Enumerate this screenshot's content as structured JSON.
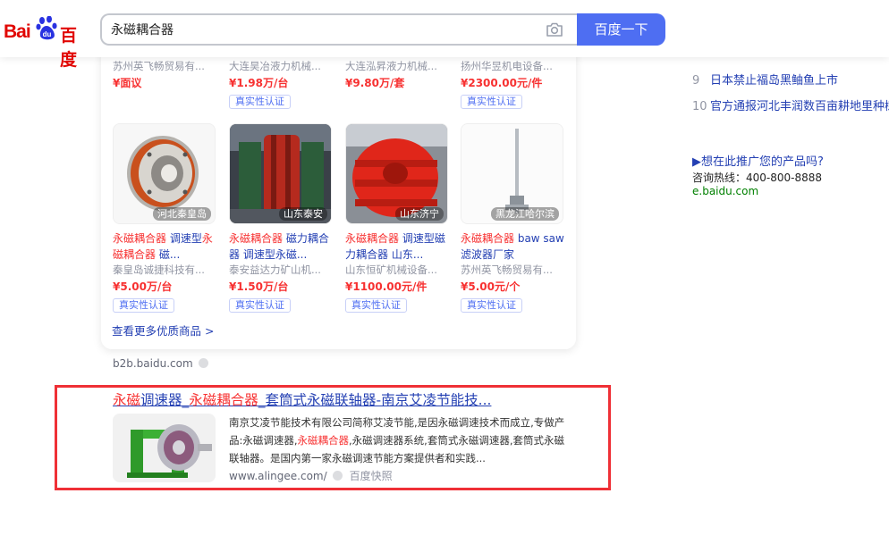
{
  "search": {
    "query": "永磁耦合器",
    "button_label": "百度一下"
  },
  "logo": {
    "text_bai": "Bai",
    "text_du": "du",
    "text_cn": "百度"
  },
  "product_top_row": [
    {
      "supplier": "苏州英飞畅贸易有...",
      "price": "¥面议",
      "verify": ""
    },
    {
      "supplier": "大连昊冶液力机械...",
      "price": "¥1.98万/台",
      "verify": "真实性认证"
    },
    {
      "supplier": "大连泓昇液力机械...",
      "price": "¥9.80万/套",
      "verify": ""
    },
    {
      "supplier": "扬州华昱机电设备...",
      "price": "¥2300.00元/件",
      "verify": "真实性认证"
    }
  ],
  "product_second_row": [
    {
      "location": "河北秦皇岛",
      "title_hl1": "永磁耦合器",
      "title_mid": " 调速型",
      "title_hl2": "永磁耦合器",
      "title_end": " 磁...",
      "supplier": "秦皇岛诚捷科技有...",
      "price": "¥5.00万/台",
      "verify": "真实性认证"
    },
    {
      "location": "山东泰安",
      "title_hl1": "永磁耦合器",
      "title_mid": " 磁力耦合器 调速型永磁...",
      "title_hl2": "",
      "title_end": "",
      "supplier": "泰安益达力矿山机...",
      "price": "¥1.50万/台",
      "verify": "真实性认证"
    },
    {
      "location": "山东济宁",
      "title_hl1": "永磁耦合器",
      "title_mid": " 调速型磁力耦合器 山东...",
      "title_hl2": "",
      "title_end": "",
      "supplier": "山东恒矿机械设备...",
      "price": "¥1100.00元/件",
      "verify": "真实性认证"
    },
    {
      "location": "黑龙江哈尔滨",
      "title_hl1": "永磁耦合器",
      "title_mid": " baw saw 滤波器厂家",
      "title_hl2": "",
      "title_end": "",
      "supplier": "苏州英飞畅贸易有...",
      "price": "¥5.00元/个",
      "verify": "真实性认证"
    }
  ],
  "more_link": "查看更多优质商品 >",
  "b2b_source": "b2b.baidu.com",
  "result": {
    "title_hl1": "永磁",
    "title_p1": "调速器_",
    "title_hl2": "永磁耦合器",
    "title_p2": "_套筒式永磁联轴器-南京艾凌节能技...",
    "abstract_p1": "南京艾凌节能技术有限公司简称艾凌节能,是因永磁调速技术而成立,专做产品:永磁调速器,",
    "abstract_hl": "永磁耦合器",
    "abstract_p2": ",永磁调速器系统,套筒式永磁调速器,套筒式永磁联轴器。是国内第一家永磁调速节能方案提供者和实践...",
    "url": "www.alingee.com/",
    "snapshot": "百度快照"
  },
  "hot_list": [
    {
      "num": "9",
      "text": "日本禁止福岛黑鲉鱼上市"
    },
    {
      "num": "10",
      "text": "官方通报河北丰润数百亩耕地里种树"
    }
  ],
  "promo": {
    "title": "▶想在此推广您的产品吗?",
    "phone": "咨询热线：400-800-8888",
    "domain": "e.baidu.com"
  },
  "colors": {
    "accent": "#4e6ef2",
    "highlight": "#f73131",
    "link": "#2440b3",
    "frame": "#ef3036"
  }
}
